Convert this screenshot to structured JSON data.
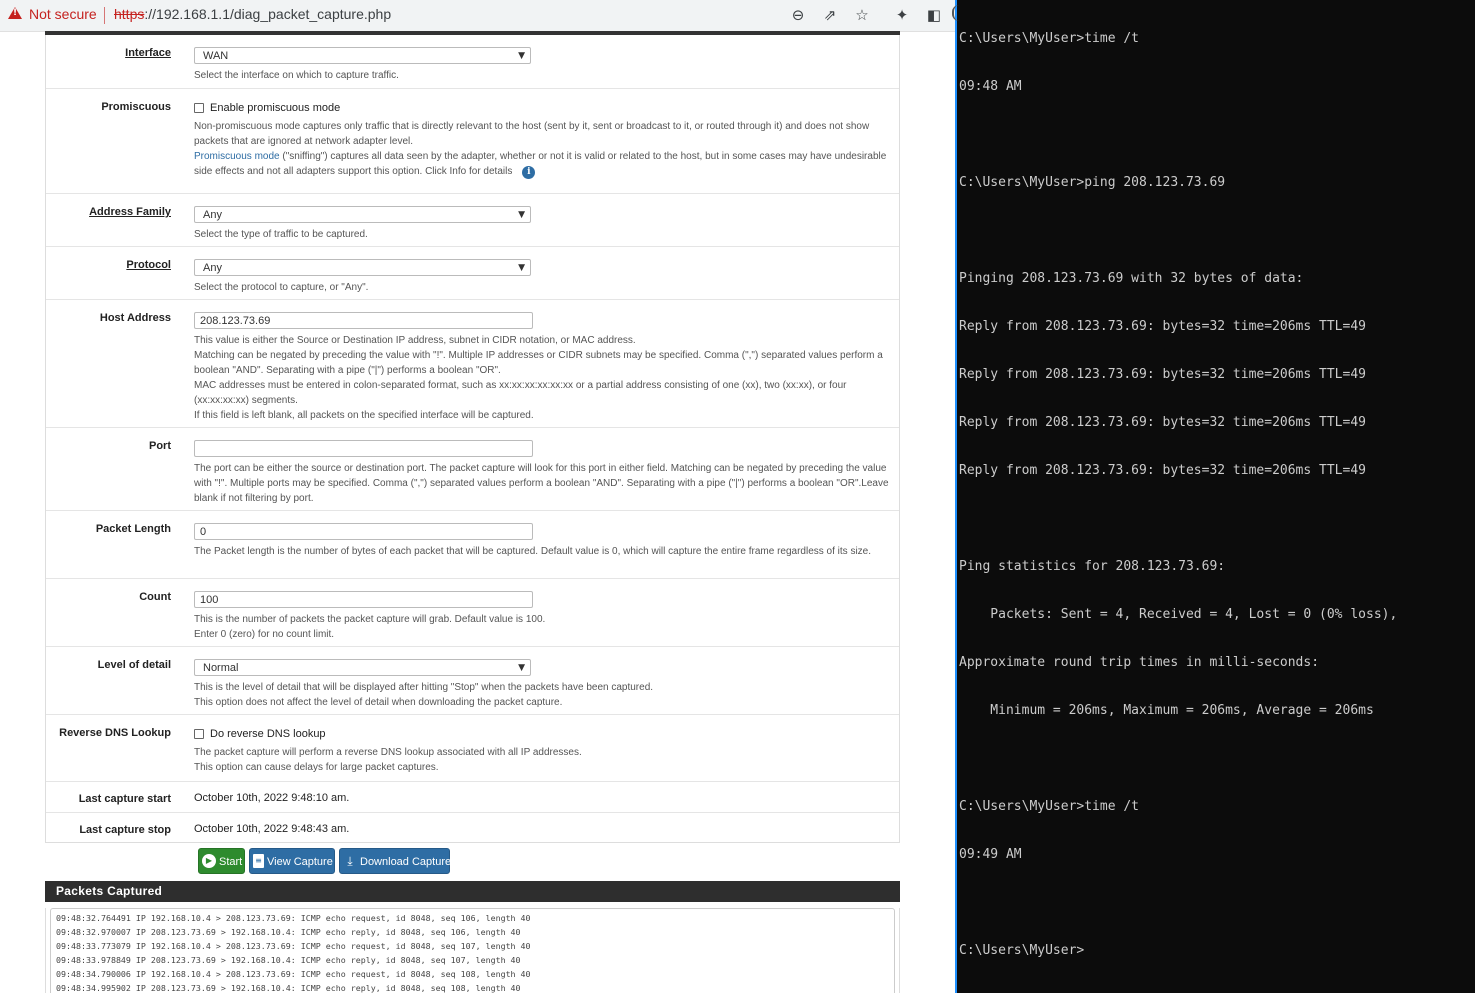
{
  "browser": {
    "security_label": "Not secure",
    "url_scheme": "https",
    "url_rest": "://192.168.1.1/diag_packet_capture.php",
    "toolbar_icons": [
      "zoom-icon",
      "share-icon",
      "bookmark-star-icon",
      "extensions-icon",
      "sidebar-icon"
    ]
  },
  "form": {
    "interface": {
      "label": "Interface",
      "value": "WAN",
      "help": "Select the interface on which to capture traffic."
    },
    "promiscuous": {
      "label": "Promiscuous",
      "checkbox_label": "Enable promiscuous mode",
      "checked": false,
      "help1": "Non-promiscuous mode captures only traffic that is directly relevant to the host (sent by it, sent or broadcast to it, or routed through it) and does not show packets that are ignored at network adapter level.",
      "help_link": "Promiscuous mode",
      "help2": " (\"sniffing\") captures all data seen by the adapter, whether or not it is valid or related to the host, but in some cases may have undesirable side effects and not all adapters support this option. Click Info for details"
    },
    "address_family": {
      "label": "Address Family",
      "value": "Any",
      "help": "Select the type of traffic to be captured."
    },
    "protocol": {
      "label": "Protocol",
      "value": "Any",
      "help": "Select the protocol to capture, or \"Any\"."
    },
    "host_address": {
      "label": "Host Address",
      "value": "208.123.73.69",
      "help": [
        "This value is either the Source or Destination IP address, subnet in CIDR notation, or MAC address.",
        "Matching can be negated by preceding the value with \"!\". Multiple IP addresses or CIDR subnets may be specified. Comma (\",\") separated values perform a boolean \"AND\". Separating with a pipe (\"|\") performs a boolean \"OR\".",
        "MAC addresses must be entered in colon-separated format, such as xx:xx:xx:xx:xx:xx or a partial address consisting of one (xx), two (xx:xx), or four (xx:xx:xx:xx) segments.",
        "If this field is left blank, all packets on the specified interface will be captured."
      ]
    },
    "port": {
      "label": "Port",
      "value": "",
      "help": "The port can be either the source or destination port. The packet capture will look for this port in either field. Matching can be negated by preceding the value with \"!\". Multiple ports may be specified. Comma (\",\") separated values perform a boolean \"AND\". Separating with a pipe (\"|\") performs a boolean \"OR\".Leave blank if not filtering by port."
    },
    "packet_length": {
      "label": "Packet Length",
      "value": "0",
      "help": "The Packet length is the number of bytes of each packet that will be captured. Default value is 0, which will capture the entire frame regardless of its size."
    },
    "count": {
      "label": "Count",
      "value": "100",
      "help1": "This is the number of packets the packet capture will grab. Default value is 100.",
      "help2": "Enter 0 (zero) for no count limit."
    },
    "level_of_detail": {
      "label": "Level of detail",
      "value": "Normal",
      "help1": "This is the level of detail that will be displayed after hitting \"Stop\" when the packets have been captured.",
      "help2": "This option does not affect the level of detail when downloading the packet capture."
    },
    "reverse_dns": {
      "label": "Reverse DNS Lookup",
      "checkbox_label": "Do reverse DNS lookup",
      "checked": false,
      "help1": "The packet capture will perform a reverse DNS lookup associated with all IP addresses.",
      "help2": "This option can cause delays for large packet captures."
    },
    "last_start": {
      "label": "Last capture start",
      "value": "October 10th, 2022 9:48:10 am."
    },
    "last_stop": {
      "label": "Last capture stop",
      "value": "October 10th, 2022 9:48:43 am."
    }
  },
  "buttons": {
    "start": "Start",
    "view": "View Capture",
    "download": "Download Capture"
  },
  "packets": {
    "title": "Packets Captured",
    "lines": [
      "09:48:32.764491 IP 192.168.10.4 > 208.123.73.69: ICMP echo request, id 8048, seq 106, length 40",
      "09:48:32.970007 IP 208.123.73.69 > 192.168.10.4: ICMP echo reply, id 8048, seq 106, length 40",
      "09:48:33.773079 IP 192.168.10.4 > 208.123.73.69: ICMP echo request, id 8048, seq 107, length 40",
      "09:48:33.978849 IP 208.123.73.69 > 192.168.10.4: ICMP echo reply, id 8048, seq 107, length 40",
      "09:48:34.790006 IP 192.168.10.4 > 208.123.73.69: ICMP echo request, id 8048, seq 108, length 40",
      "09:48:34.995902 IP 208.123.73.69 > 192.168.10.4: ICMP echo reply, id 8048, seq 108, length 40"
    ]
  },
  "terminal": {
    "lines": [
      "C:\\Users\\MyUser>time /t",
      "09:48 AM",
      "",
      "C:\\Users\\MyUser>ping 208.123.73.69",
      "",
      "Pinging 208.123.73.69 with 32 bytes of data:",
      "Reply from 208.123.73.69: bytes=32 time=206ms TTL=49",
      "Reply from 208.123.73.69: bytes=32 time=206ms TTL=49",
      "Reply from 208.123.73.69: bytes=32 time=206ms TTL=49",
      "Reply from 208.123.73.69: bytes=32 time=206ms TTL=49",
      "",
      "Ping statistics for 208.123.73.69:",
      "    Packets: Sent = 4, Received = 4, Lost = 0 (0% loss),",
      "Approximate round trip times in milli-seconds:",
      "    Minimum = 206ms, Maximum = 206ms, Average = 206ms",
      "",
      "C:\\Users\\MyUser>time /t",
      "09:49 AM",
      "",
      "C:\\Users\\MyUser>"
    ]
  },
  "colors": {
    "insecure_red": "#c5221f",
    "start_green": "#2e8b2e",
    "action_blue": "#2e6da4",
    "terminal_bg": "#0c0c0c",
    "terminal_text": "#cccccc"
  }
}
